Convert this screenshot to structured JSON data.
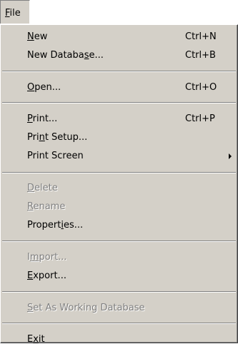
{
  "menubar": {
    "file_label": "File",
    "file_mnemonic_index": 0
  },
  "menu": {
    "items": [
      {
        "label": "New",
        "mnemonic": 0,
        "shortcut": "Ctrl+N",
        "enabled": true,
        "submenu": false
      },
      {
        "label": "New Database...",
        "mnemonic": 10,
        "shortcut": "Ctrl+B",
        "enabled": true,
        "submenu": false
      },
      {
        "separator": true
      },
      {
        "label": "Open...",
        "mnemonic": 0,
        "shortcut": "Ctrl+O",
        "enabled": true,
        "submenu": false
      },
      {
        "separator": true
      },
      {
        "label": "Print...",
        "mnemonic": 0,
        "shortcut": "Ctrl+P",
        "enabled": true,
        "submenu": false
      },
      {
        "label": "Print Setup...",
        "mnemonic": 3,
        "shortcut": "",
        "enabled": true,
        "submenu": false
      },
      {
        "label": "Print Screen",
        "mnemonic": -1,
        "shortcut": "",
        "enabled": true,
        "submenu": true
      },
      {
        "separator": true
      },
      {
        "label": "Delete",
        "mnemonic": 0,
        "shortcut": "",
        "enabled": false,
        "submenu": false
      },
      {
        "label": "Rename",
        "mnemonic": 0,
        "shortcut": "",
        "enabled": false,
        "submenu": false
      },
      {
        "label": "Properties...",
        "mnemonic": 7,
        "shortcut": "",
        "enabled": true,
        "submenu": false
      },
      {
        "separator": true
      },
      {
        "label": "Import...",
        "mnemonic": 1,
        "shortcut": "",
        "enabled": false,
        "submenu": false
      },
      {
        "label": "Export...",
        "mnemonic": 0,
        "shortcut": "",
        "enabled": true,
        "submenu": false
      },
      {
        "separator": true
      },
      {
        "label": "Set As Working Database",
        "mnemonic": 0,
        "shortcut": "",
        "enabled": false,
        "submenu": false
      },
      {
        "separator": true
      },
      {
        "label": "Exit",
        "mnemonic": 1,
        "shortcut": "",
        "enabled": true,
        "submenu": false
      }
    ]
  },
  "colors": {
    "menu_face": "#d4d0c8",
    "disabled_text": "#808080",
    "separator_dark": "#808080",
    "separator_light": "#ffffff"
  }
}
